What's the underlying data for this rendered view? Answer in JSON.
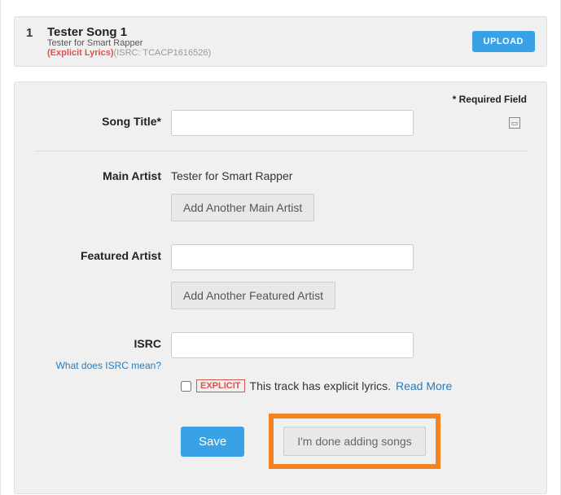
{
  "track": {
    "number": "1",
    "title": "Tester Song 1",
    "artist": "Tester for Smart Rapper",
    "explicit_label": "(Explicit Lyrics)",
    "isrc_label": "(ISRC: TCACP1616526)",
    "upload_label": "UPLOAD"
  },
  "form": {
    "required_note": "* Required Field",
    "song_title_label": "Song Title*",
    "main_artist_label": "Main Artist",
    "main_artist_value": "Tester for Smart Rapper",
    "add_main_artist_btn": "Add Another Main Artist",
    "featured_artist_label": "Featured Artist",
    "add_featured_artist_btn": "Add Another Featured Artist",
    "isrc_label": "ISRC",
    "isrc_help": "What does ISRC mean?",
    "explicit_tag": "EXPLICIT",
    "explicit_text": "This track has explicit lyrics.",
    "read_more": "Read More",
    "save_label": "Save",
    "done_label": "I'm done adding songs"
  }
}
